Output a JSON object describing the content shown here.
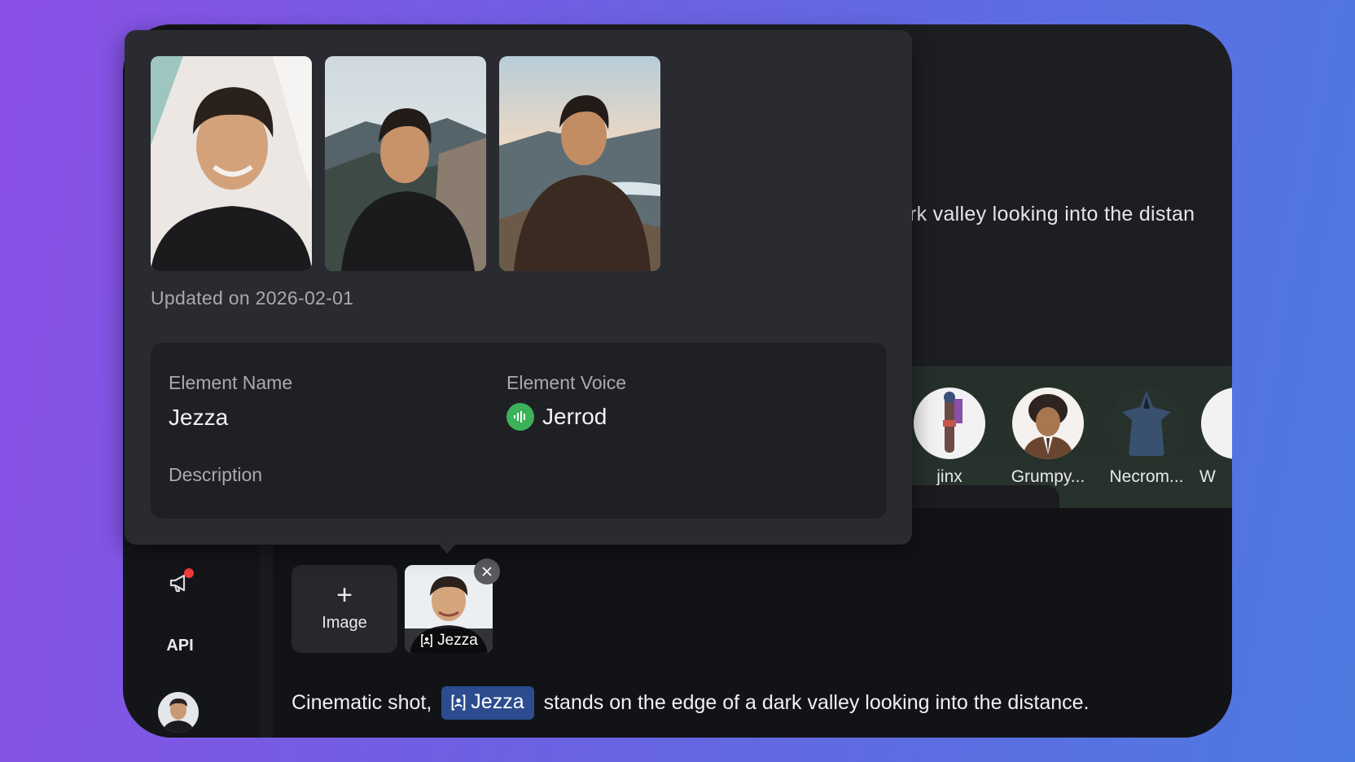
{
  "rail": {
    "api_label": "API"
  },
  "background": {
    "prompt_fragment": "rk valley looking into the distan"
  },
  "characters": [
    {
      "name": "jinx"
    },
    {
      "name": "Grumpy..."
    },
    {
      "name": "Necrom..."
    },
    {
      "name": "W"
    }
  ],
  "attachments": {
    "add_label": "Image",
    "add_icon": "+",
    "element_caption": "Jezza"
  },
  "prompt": {
    "before": "Cinematic shot,",
    "chip": "Jezza",
    "after": "stands on the edge of a dark valley looking into the distance."
  },
  "popup": {
    "updated": "Updated on 2026-02-01",
    "name_label": "Element Name",
    "name_value": "Jezza",
    "voice_label": "Element Voice",
    "voice_value": "Jerrod",
    "description_label": "Description"
  },
  "colors": {
    "accent_chip": "#2c4c8f",
    "voice_green": "#3cb15a",
    "notification_red": "#ee3a3a"
  }
}
